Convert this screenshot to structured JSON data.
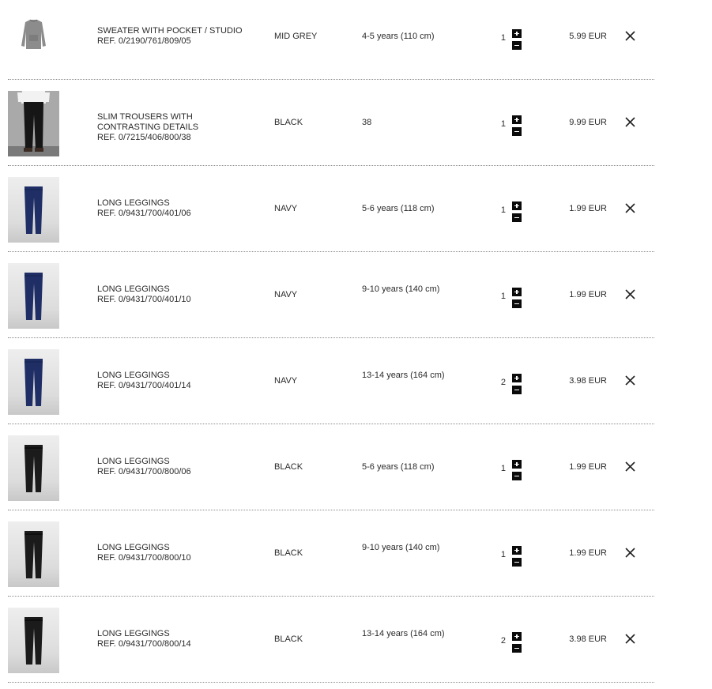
{
  "cart": {
    "items": [
      {
        "name": "SWEATER WITH POCKET / STUDIO",
        "ref": "REF. 0/2190/761/809/05",
        "color": "MID GREY",
        "size": "4-5 years (110 cm)",
        "quantity": "1",
        "price": "5.99 EUR",
        "thumbnail": "grey-sweater"
      },
      {
        "name": "SLIM TROUSERS WITH CONTRASTING DETAILS",
        "ref": "REF. 0/7215/406/800/38",
        "color": "BLACK",
        "size": "38",
        "quantity": "1",
        "price": "9.99 EUR",
        "thumbnail": "model-black-trousers"
      },
      {
        "name": "LONG LEGGINGS",
        "ref": "REF. 0/9431/700/401/06",
        "color": "NAVY",
        "size": "5-6 years (118 cm)",
        "quantity": "1",
        "price": "1.99 EUR",
        "thumbnail": "navy-leggings"
      },
      {
        "name": "LONG LEGGINGS",
        "ref": "REF. 0/9431/700/401/10",
        "color": "NAVY",
        "size": "9-10 years (140 cm)",
        "quantity": "1",
        "price": "1.99 EUR",
        "thumbnail": "navy-leggings"
      },
      {
        "name": "LONG LEGGINGS",
        "ref": "REF. 0/9431/700/401/14",
        "color": "NAVY",
        "size": "13-14 years (164 cm)",
        "quantity": "2",
        "price": "3.98 EUR",
        "thumbnail": "navy-leggings"
      },
      {
        "name": "LONG LEGGINGS",
        "ref": "REF. 0/9431/700/800/06",
        "color": "BLACK",
        "size": "5-6 years (118 cm)",
        "quantity": "1",
        "price": "1.99 EUR",
        "thumbnail": "black-leggings"
      },
      {
        "name": "LONG LEGGINGS",
        "ref": "REF. 0/9431/700/800/10",
        "color": "BLACK",
        "size": "9-10 years (140 cm)",
        "quantity": "1",
        "price": "1.99 EUR",
        "thumbnail": "black-leggings"
      },
      {
        "name": "LONG LEGGINGS",
        "ref": "REF. 0/9431/700/800/14",
        "color": "BLACK",
        "size": "13-14 years (164 cm)",
        "quantity": "2",
        "price": "3.98 EUR",
        "thumbnail": "black-leggings"
      }
    ]
  },
  "icons": {
    "increase": "plus-icon",
    "decrease": "minus-icon",
    "remove": "close-icon"
  },
  "colors": {
    "navy_garment": "#1f2f66",
    "black_garment": "#1b1b1b",
    "grey_garment": "#8c8c8c",
    "qty_button": "#0a0a0a",
    "divider": "#8a8a8a"
  }
}
